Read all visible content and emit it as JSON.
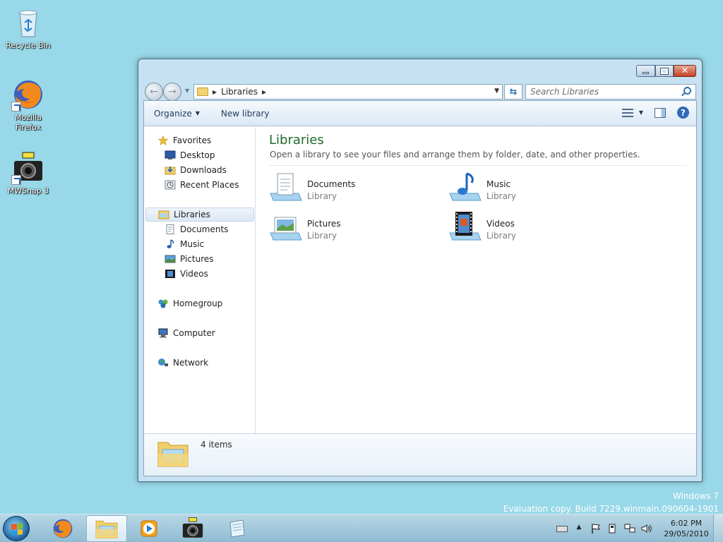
{
  "desktop": {
    "icons": [
      {
        "label": "Recycle Bin",
        "icon": "recycle-bin-icon"
      },
      {
        "label": "Mozilla Firefox",
        "icon": "firefox-icon"
      },
      {
        "label": "MWSnap 3",
        "icon": "camera-icon"
      }
    ],
    "watermark": {
      "line1": "Windows 7",
      "line2": "Evaluation copy. Build 7229.winmain.090604-1901"
    }
  },
  "window": {
    "address": {
      "crumb": "Libraries"
    },
    "search": {
      "placeholder": "Search Libraries"
    },
    "toolbar": {
      "organize": "Organize",
      "new_library": "New library"
    },
    "nav": {
      "favorites": "Favorites",
      "desktop": "Desktop",
      "downloads": "Downloads",
      "recent_places": "Recent Places",
      "libraries": "Libraries",
      "documents": "Documents",
      "music": "Music",
      "pictures": "Pictures",
      "videos": "Videos",
      "homegroup": "Homegroup",
      "computer": "Computer",
      "network": "Network"
    },
    "content": {
      "title": "Libraries",
      "subtitle": "Open a library to see your files and arrange them by folder, date, and other properties.",
      "libraries": [
        {
          "name": "Documents",
          "type": "Library",
          "icon": "documents-library-icon"
        },
        {
          "name": "Music",
          "type": "Library",
          "icon": "music-library-icon"
        },
        {
          "name": "Pictures",
          "type": "Library",
          "icon": "pictures-library-icon"
        },
        {
          "name": "Videos",
          "type": "Library",
          "icon": "videos-library-icon"
        }
      ]
    },
    "details": {
      "count": "4 items"
    }
  },
  "taskbar": {
    "clock": {
      "time": "6:02 PM",
      "date": "29/05/2010"
    }
  },
  "colors": {
    "desktop_bg": "#98d8e8",
    "title_green": "#1e6a2e",
    "accent_blue": "#2f6ab5"
  }
}
